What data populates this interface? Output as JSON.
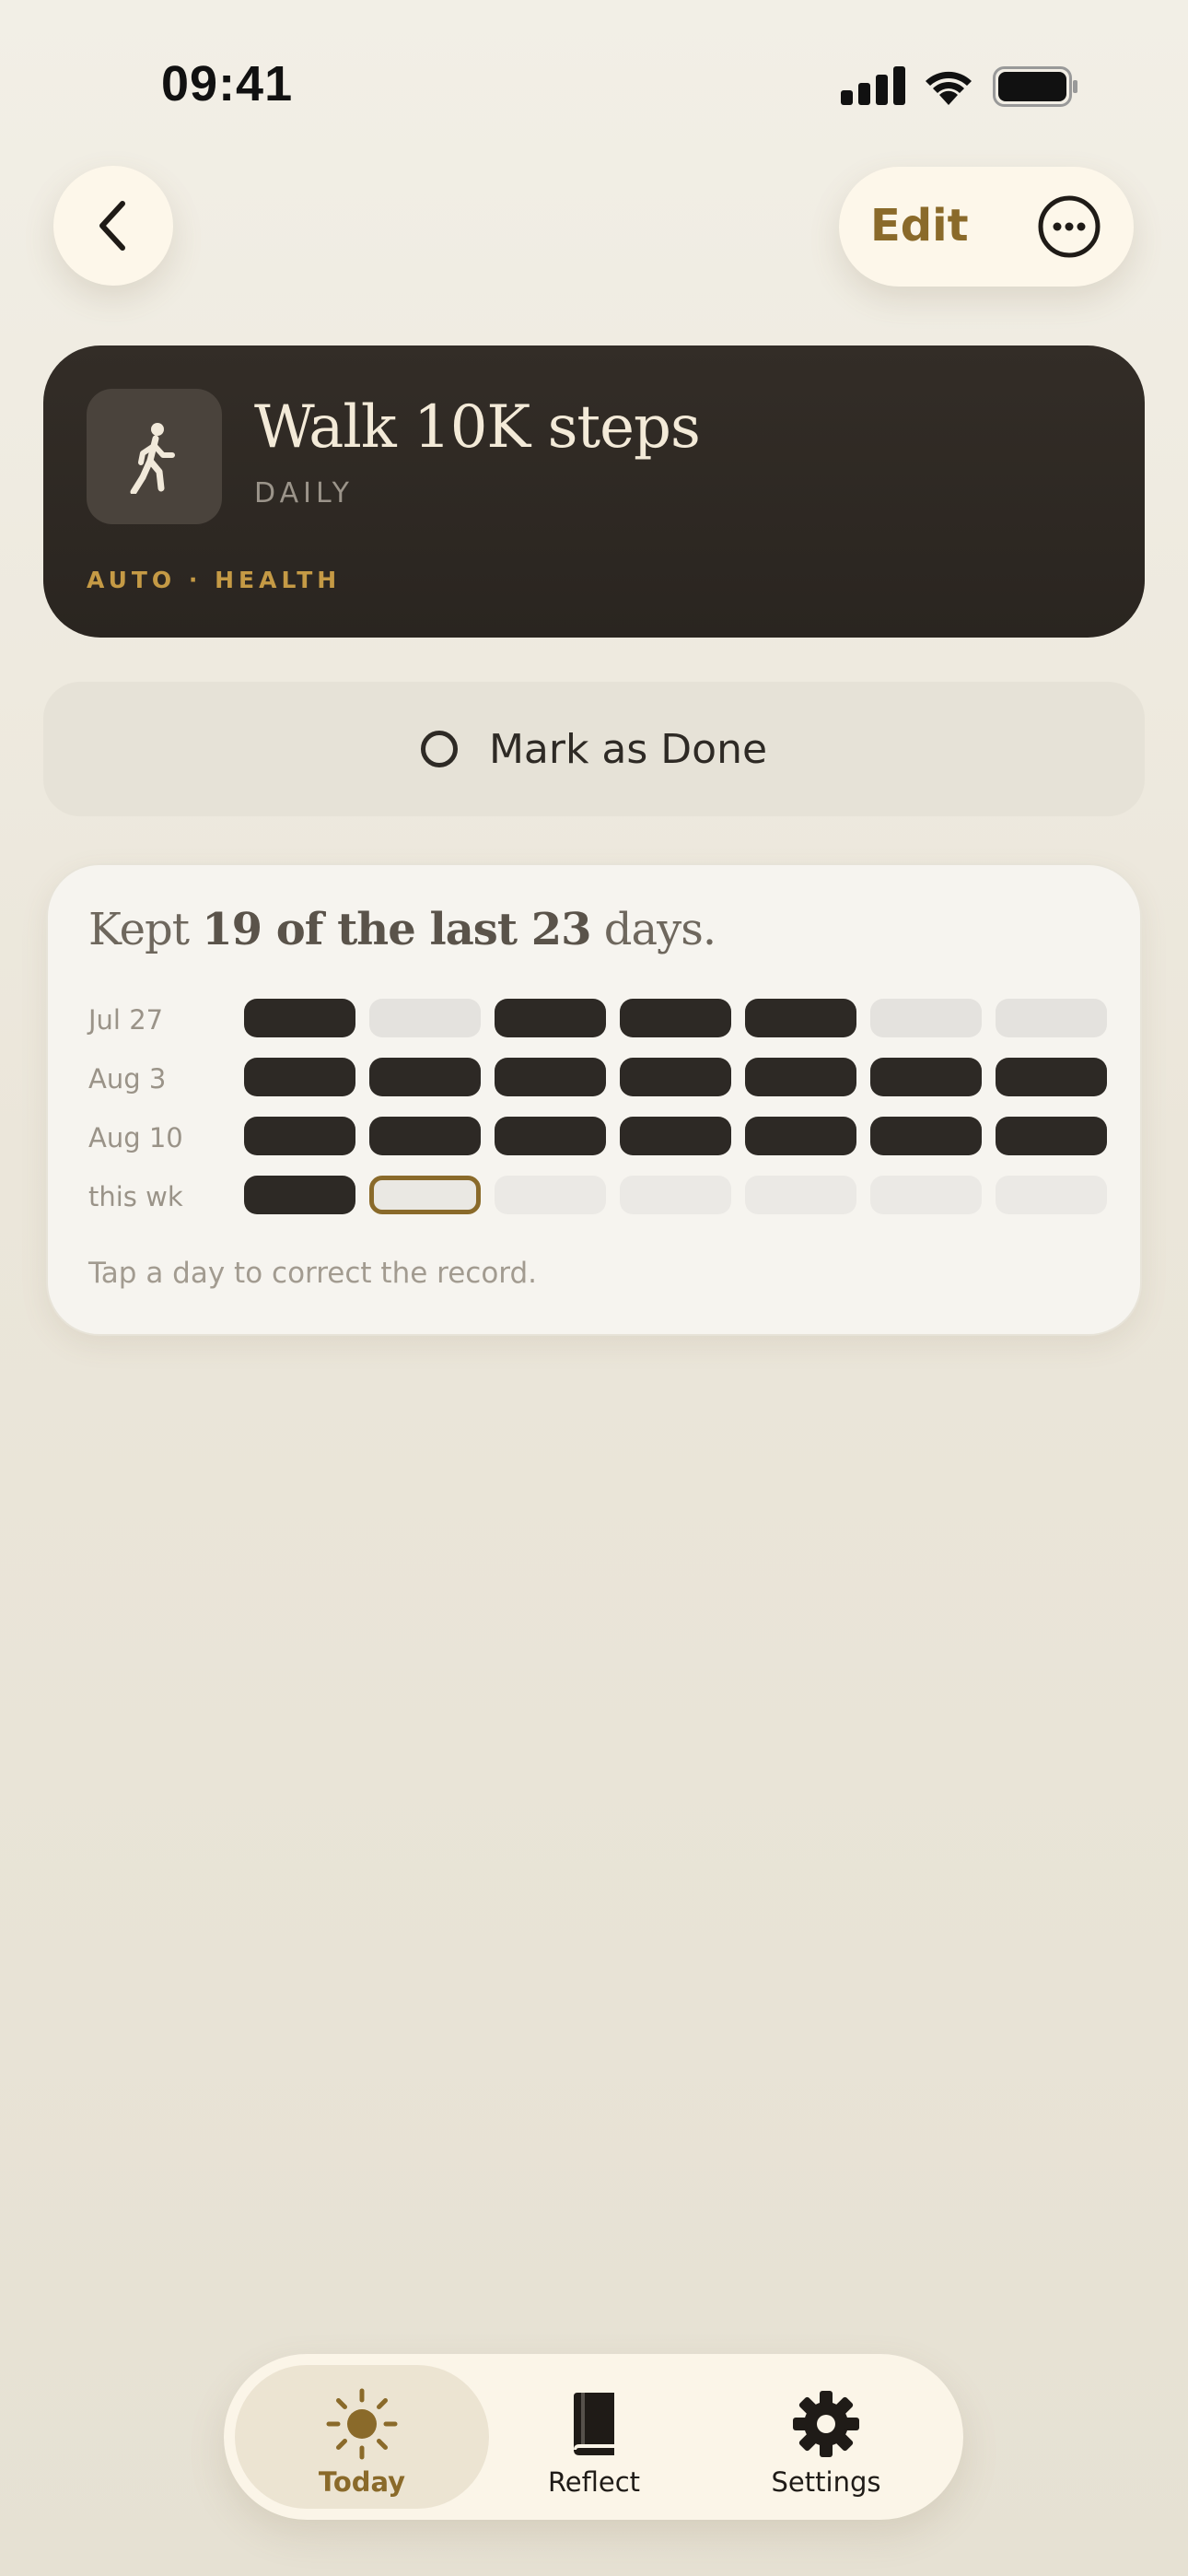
{
  "status_bar": {
    "time": "09:41"
  },
  "nav": {
    "edit_label": "Edit"
  },
  "habit": {
    "title": "Walk 10K steps",
    "frequency": "DAILY",
    "tag": "AUTO · HEALTH",
    "icon": "walking-person-icon"
  },
  "action": {
    "mark_label": "Mark as Done"
  },
  "stats": {
    "headline_prefix": "Kept ",
    "kept": "19",
    "headline_mid": " of the last ",
    "total": "23",
    "headline_suffix": " days.",
    "rows": [
      {
        "label": "Jul 27",
        "days": [
          "done",
          "missed",
          "done",
          "done",
          "done",
          "missed",
          "missed"
        ]
      },
      {
        "label": "Aug 3",
        "days": [
          "done",
          "done",
          "done",
          "done",
          "done",
          "done",
          "done"
        ]
      },
      {
        "label": "Aug 10",
        "days": [
          "done",
          "done",
          "done",
          "done",
          "done",
          "done",
          "done"
        ]
      },
      {
        "label": "this wk",
        "days": [
          "done",
          "today",
          "future",
          "future",
          "future",
          "future",
          "future"
        ]
      }
    ],
    "hint": "Tap a day to correct the record."
  },
  "tabs": [
    {
      "label": "Today",
      "icon": "sun-icon",
      "active": true
    },
    {
      "label": "Reflect",
      "icon": "book-icon",
      "active": false
    },
    {
      "label": "Settings",
      "icon": "gear-icon",
      "active": false
    }
  ],
  "colors": {
    "accent": "#8a6a2a",
    "dark": "#2d2925",
    "tag": "#c59a45"
  }
}
